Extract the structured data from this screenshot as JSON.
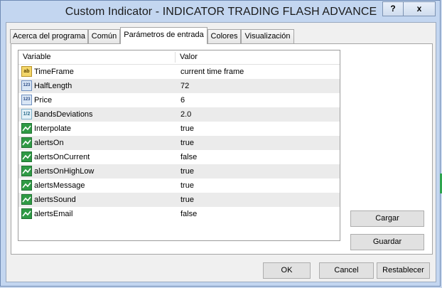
{
  "window": {
    "title": "Custom Indicator - INDICATOR TRADING FLASH ADVANCE",
    "help_label": "?",
    "close_label": "x"
  },
  "tabs": [
    {
      "label": "Acerca del programa",
      "active": false
    },
    {
      "label": "Común",
      "active": false
    },
    {
      "label": "Parámetros de entrada",
      "active": true
    },
    {
      "label": "Colores",
      "active": false
    },
    {
      "label": "Visualización",
      "active": false
    }
  ],
  "grid": {
    "headers": {
      "variable": "Variable",
      "value": "Valor"
    },
    "rows": [
      {
        "icon": "string-type-icon",
        "icon_text": "ab",
        "name": "TimeFrame",
        "value": "current time frame"
      },
      {
        "icon": "integer-type-icon",
        "icon_text": "123",
        "name": "HalfLength",
        "value": "72"
      },
      {
        "icon": "integer-type-icon",
        "icon_text": "123",
        "name": "Price",
        "value": "6"
      },
      {
        "icon": "double-type-icon",
        "icon_text": "1/2",
        "name": "BandsDeviations",
        "value": "2.0"
      },
      {
        "icon": "boolean-type-icon",
        "icon_text": "",
        "name": "Interpolate",
        "value": "true"
      },
      {
        "icon": "boolean-type-icon",
        "icon_text": "",
        "name": "alertsOn",
        "value": "true"
      },
      {
        "icon": "boolean-type-icon",
        "icon_text": "",
        "name": "alertsOnCurrent",
        "value": "false"
      },
      {
        "icon": "boolean-type-icon",
        "icon_text": "",
        "name": "alertsOnHighLow",
        "value": "true"
      },
      {
        "icon": "boolean-type-icon",
        "icon_text": "",
        "name": "alertsMessage",
        "value": "true"
      },
      {
        "icon": "boolean-type-icon",
        "icon_text": "",
        "name": "alertsSound",
        "value": "true"
      },
      {
        "icon": "boolean-type-icon",
        "icon_text": "",
        "name": "alertsEmail",
        "value": "false"
      }
    ]
  },
  "side_buttons": {
    "load": "Cargar",
    "save": "Guardar"
  },
  "footer_buttons": {
    "ok": "OK",
    "cancel": "Cancel",
    "reset": "Restablecer"
  },
  "colors": {
    "titlebar": "#c3d6f0",
    "bool_icon": "#2f9a45",
    "string_icon": "#f3d66a"
  }
}
